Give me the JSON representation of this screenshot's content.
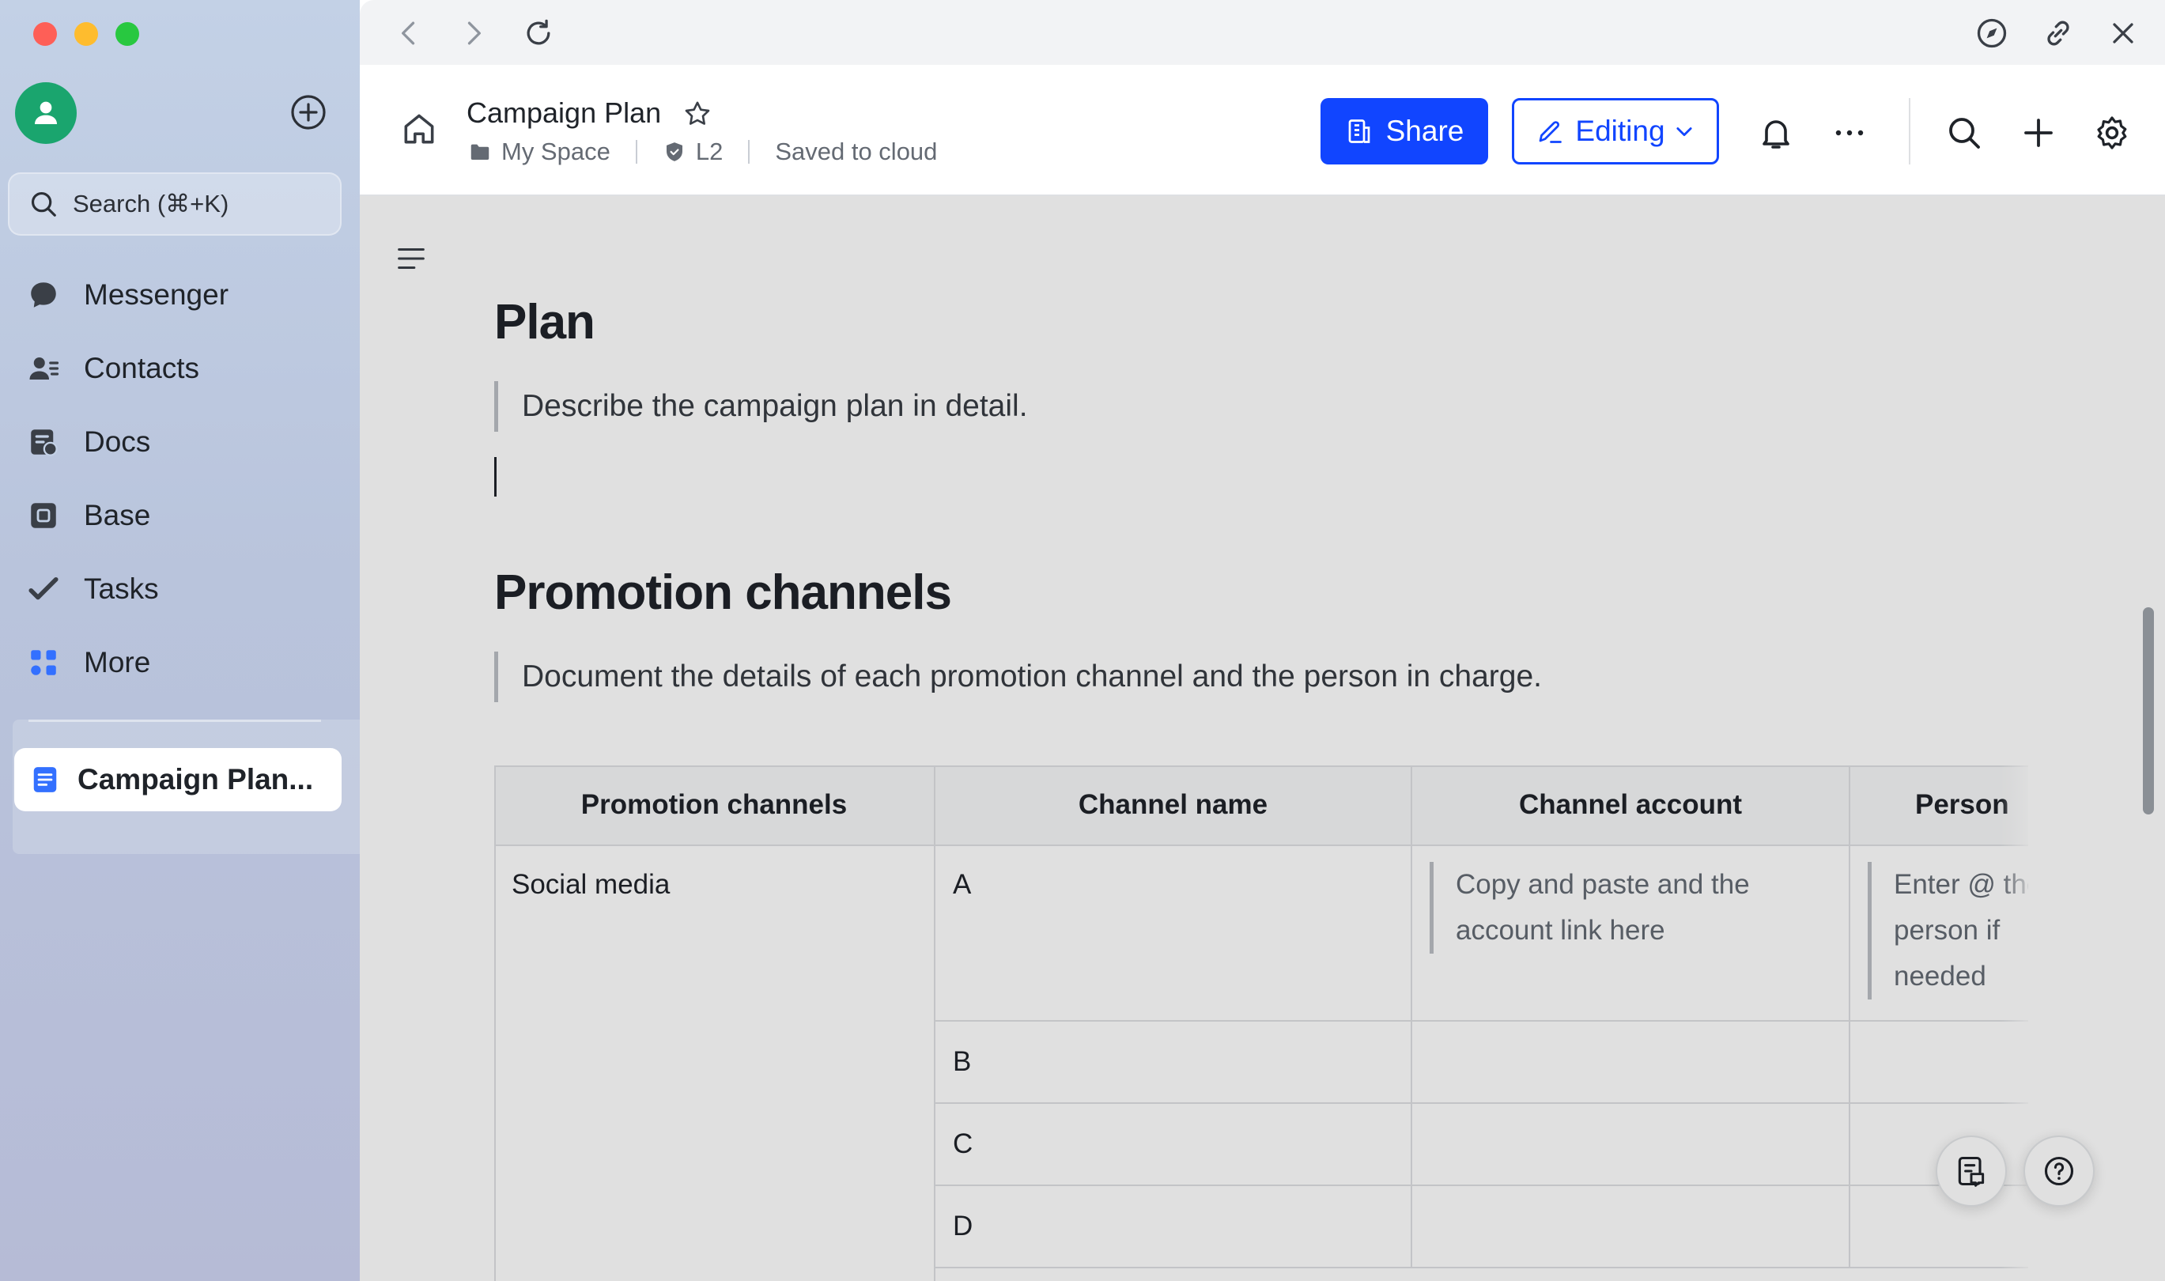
{
  "sidebar": {
    "search_placeholder": "Search (⌘+K)",
    "items": [
      {
        "label": "Messenger",
        "icon": "messenger-icon"
      },
      {
        "label": "Contacts",
        "icon": "contacts-icon"
      },
      {
        "label": "Docs",
        "icon": "docs-icon"
      },
      {
        "label": "Base",
        "icon": "base-icon"
      },
      {
        "label": "Tasks",
        "icon": "tasks-icon"
      },
      {
        "label": "More",
        "icon": "more-apps-icon"
      }
    ],
    "open_doc": "Campaign Plan..."
  },
  "header": {
    "title": "Campaign Plan",
    "location": "My Space",
    "security_level": "L2",
    "save_status": "Saved to cloud",
    "share_label": "Share",
    "edit_mode_label": "Editing"
  },
  "doc": {
    "section1": {
      "heading": "Plan",
      "hint": "Describe the campaign plan in detail."
    },
    "section2": {
      "heading": "Promotion channels",
      "hint": "Document the details of each promotion channel and the person in charge."
    },
    "table": {
      "headers": [
        "Promotion channels",
        "Channel name",
        "Channel account",
        "Person"
      ],
      "group_label": "Social media",
      "channels": [
        "A",
        "B",
        "C",
        "D"
      ],
      "account_placeholder": "Copy and paste and the account link here",
      "person_placeholder": "Enter @ the person if needed"
    }
  },
  "colors": {
    "accent": "#1145ff",
    "avatar": "#1aa56e",
    "sidebar_bg": "#c3d1e6"
  }
}
